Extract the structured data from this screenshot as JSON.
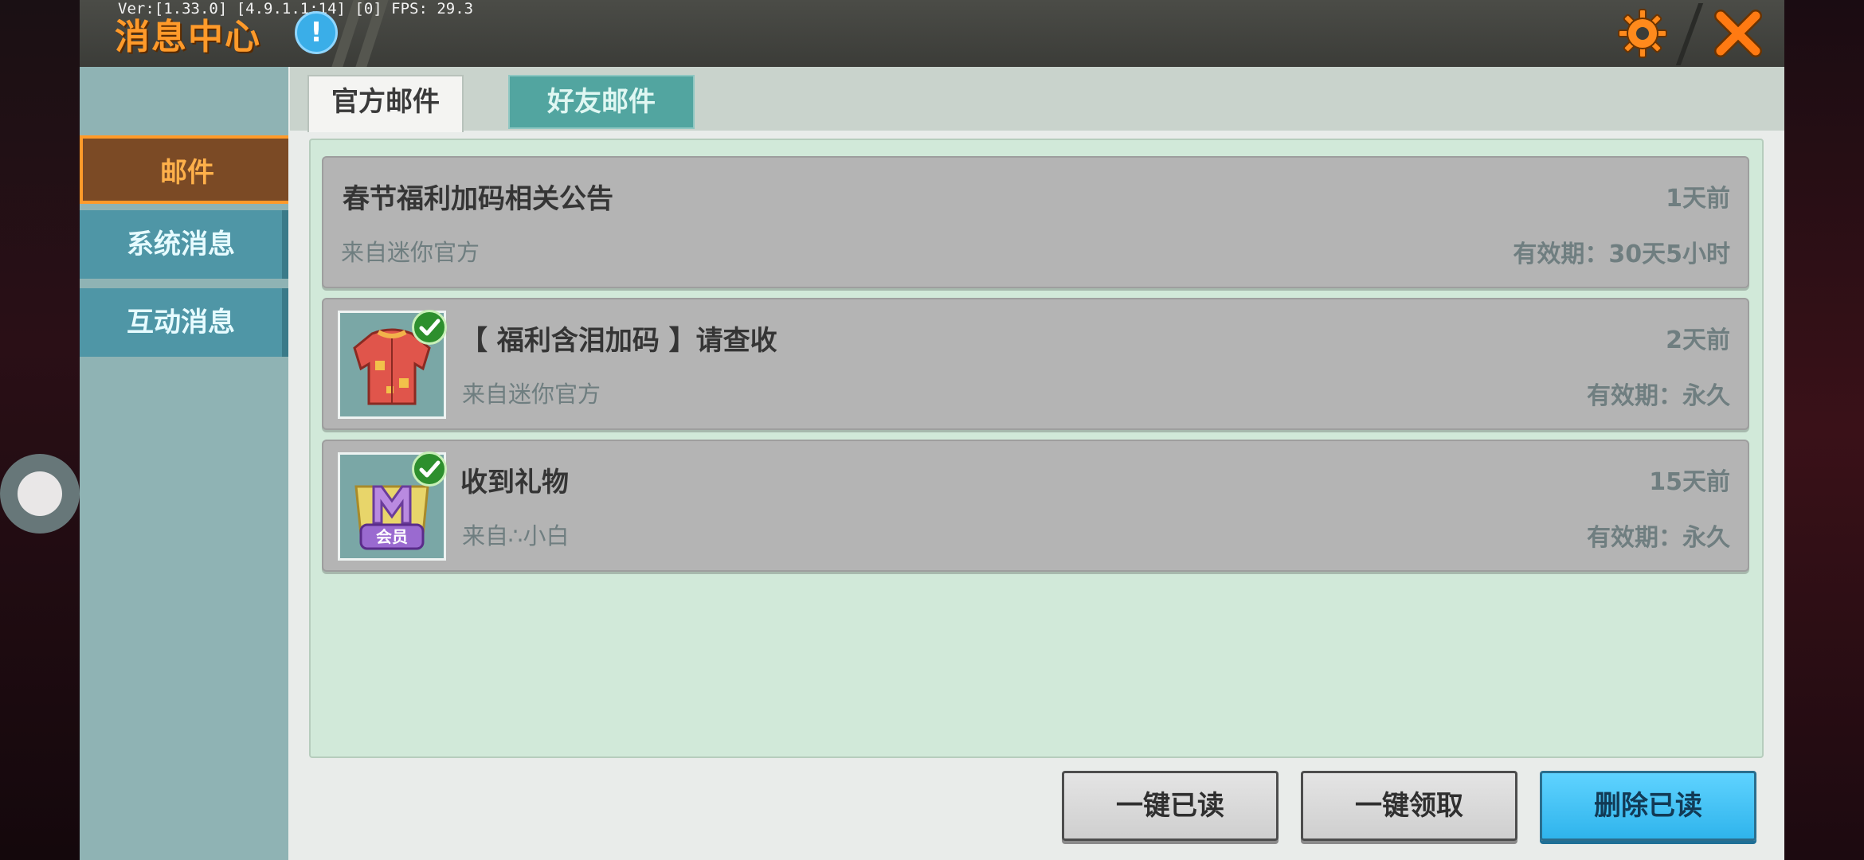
{
  "window": {
    "title": "消息中心",
    "debug_text": "Ver:[1.33.0] [4.9.1.1:14] [0] FPS: 29.3",
    "info_glyph": "!",
    "icons": [
      "info-icon",
      "gear-icon",
      "close-icon"
    ],
    "accent_color": "#ff9a2a"
  },
  "sidebar": {
    "items": [
      {
        "label": "邮件",
        "active": true
      },
      {
        "label": "系统消息",
        "active": false
      },
      {
        "label": "互动消息",
        "active": false
      }
    ]
  },
  "tabs": [
    {
      "label": "官方邮件",
      "active": true
    },
    {
      "label": "好友邮件",
      "active": false
    }
  ],
  "mails": [
    {
      "title": "春节福利加码相关公告",
      "sender": "来自迷你官方",
      "time": "1天前",
      "validity": "有效期：30天5小时",
      "has_attachment": false,
      "read": true
    },
    {
      "title": "【 福利含泪加码 】请查收",
      "sender": "来自迷你官方",
      "time": "2天前",
      "validity": "有效期：永久",
      "has_attachment": true,
      "attachment_icon": "red-jacket-icon",
      "read": true
    },
    {
      "title": "收到礼物",
      "sender": "来自∴小白",
      "time": "15天前",
      "validity": "有效期：永久",
      "has_attachment": true,
      "attachment_icon": "member-badge-icon",
      "badge_text": "会员",
      "read": true
    }
  ],
  "buttons": {
    "mark_all_read": "一键已读",
    "claim_all": "一键领取",
    "delete_read": "删除已读"
  }
}
